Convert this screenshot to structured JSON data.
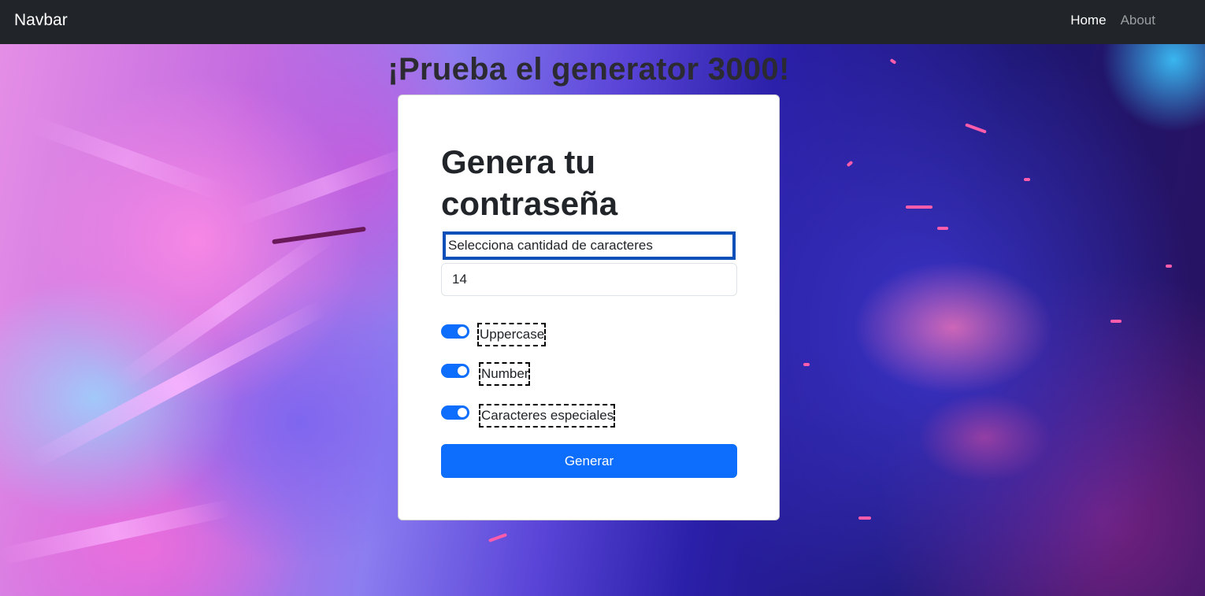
{
  "navbar": {
    "brand": "Navbar",
    "links": [
      {
        "label": "Home",
        "active": true
      },
      {
        "label": "About",
        "active": false
      }
    ]
  },
  "hero": {
    "title": "¡Prueba el generator 3000!"
  },
  "card": {
    "title": "Genera tu contraseña",
    "length_label": "Selecciona cantidad de caracteres",
    "length_value": "14",
    "options": [
      {
        "label": "Uppercase",
        "checked": true
      },
      {
        "label": "Number",
        "checked": true
      },
      {
        "label": "Caracteres especiales",
        "checked": true
      }
    ],
    "generate_label": "Generar"
  },
  "colors": {
    "navbar_bg": "#212529",
    "primary": "#0d6efd",
    "focus_outline": "#0d4fb8"
  }
}
